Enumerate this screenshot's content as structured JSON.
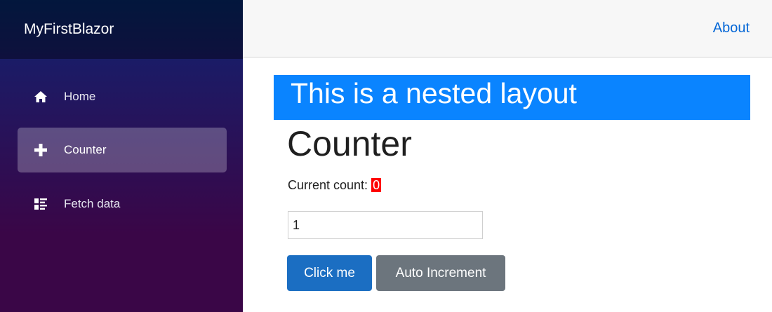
{
  "sidebar": {
    "brand": "MyFirstBlazor",
    "items": [
      {
        "label": "Home",
        "icon": "home-icon",
        "active": false
      },
      {
        "label": "Counter",
        "icon": "plus-icon",
        "active": true
      },
      {
        "label": "Fetch data",
        "icon": "list-rich-icon",
        "active": false
      }
    ]
  },
  "topbar": {
    "about_label": "About"
  },
  "main": {
    "banner_text": "This is a nested layout",
    "title": "Counter",
    "count_label": "Current count:",
    "count_value": "0",
    "increment_input_value": "1",
    "click_button_label": "Click me",
    "auto_button_label": "Auto Increment"
  },
  "colors": {
    "sidebar_top": "#052767",
    "sidebar_bottom": "#3a0647",
    "banner": "#0a84ff",
    "link": "#0366d6",
    "primary_button": "#1b6ec2",
    "secondary_button": "#6c757d",
    "count_highlight": "#ff0000"
  }
}
